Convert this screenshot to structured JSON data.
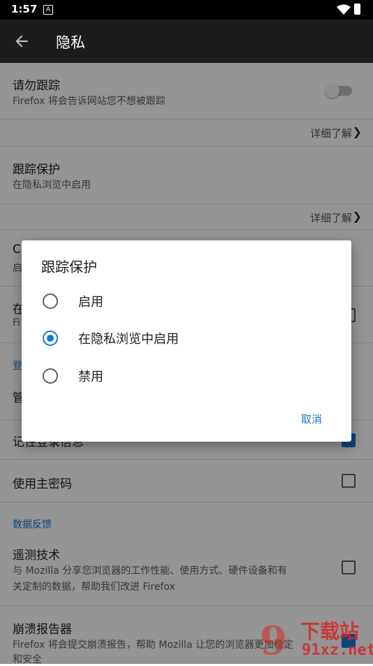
{
  "status": {
    "time": "1:57",
    "notif": "A"
  },
  "appbar": {
    "title": "隐私"
  },
  "settings": {
    "dnt_title": "请勿跟踪",
    "dnt_summary": "Firefox 将会告诉网站您不想被跟踪",
    "learn_more_1": "详细了解",
    "tp_title": "跟踪保护",
    "tp_summary": "在隐私浏览中启用",
    "learn_more_2": "详细了解",
    "partial_1": "C",
    "partial_1_sub": "启",
    "partial_2": "在",
    "partial_2_sub": "Fi",
    "partial_section": "登",
    "partial_3": "管",
    "remember_logins_partial": "记住登录信息",
    "master_password": "使用主密码",
    "section_data": "数据反馈",
    "telemetry_title": "遥测技术",
    "telemetry_summary_1": "与 Mozilla 分享您浏览器的工作性能、使用方式、硬件设备和有",
    "telemetry_summary_2": "关定制的数据，帮助我们改进 Firefox",
    "crash_title": "崩溃报告器",
    "crash_summary_1": "Firefox 将会提交崩溃报告，帮助 Mozilla 让您的浏览器更加稳定",
    "crash_summary_2": "和安全"
  },
  "dialog": {
    "title": "跟踪保护",
    "options": [
      {
        "label": "启用",
        "selected": false
      },
      {
        "label": "在隐私浏览中启用",
        "selected": true
      },
      {
        "label": "禁用",
        "selected": false
      }
    ],
    "cancel": "取消"
  },
  "watermark": {
    "logo": "9",
    "text1": "下载站",
    "text2": "91xz.net"
  },
  "colors": {
    "accent": "#1976d2",
    "appbar": "#1c1c1c"
  }
}
